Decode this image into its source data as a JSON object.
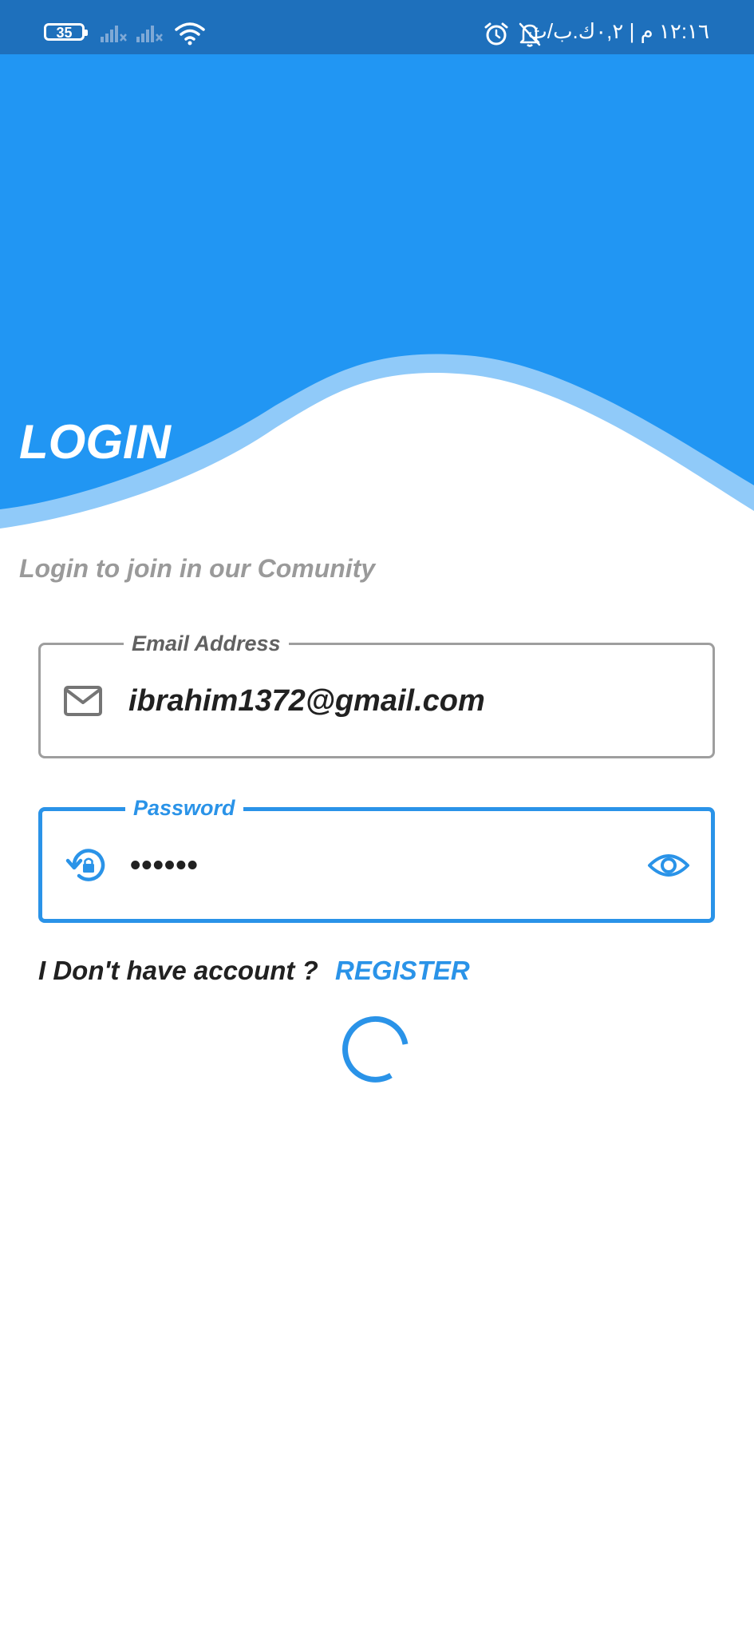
{
  "status_bar": {
    "battery_level": "35",
    "time_text": "١٢:١٦ م | ٠,٢ك.ب/ث",
    "icons": [
      "battery-icon",
      "signal-off-icon",
      "signal-off-icon",
      "wifi-icon",
      "alarm-icon",
      "bell-off-icon"
    ]
  },
  "header": {
    "title": "LOGIN",
    "color_primary": "#2196F3",
    "color_wave_light": "#90CAF9"
  },
  "subtitle": "Login to join in our Comunity",
  "form": {
    "email": {
      "label": "Email Address",
      "value": "ibrahim1372@gmail.com",
      "icon": "mail-icon"
    },
    "password": {
      "label": "Password",
      "value": "••••••",
      "icon": "lock-reset-icon",
      "toggle_icon": "eye-icon",
      "focused": true
    }
  },
  "register": {
    "prompt": "I Don't have account ?",
    "link_label": "REGISTER"
  },
  "loading": {
    "spinner_color": "#2A93E8"
  }
}
